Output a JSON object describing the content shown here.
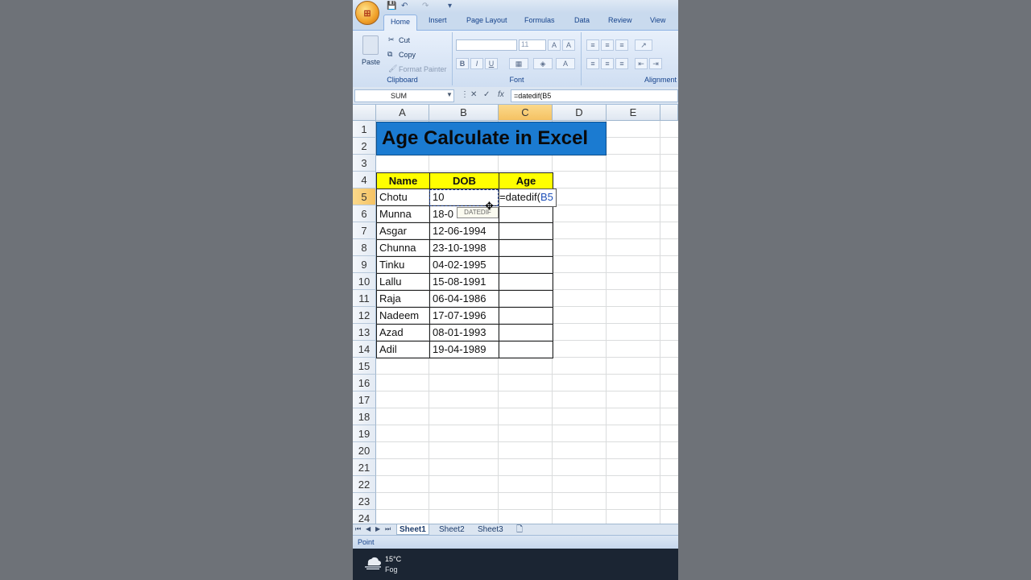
{
  "window": {
    "office_button": "⊞"
  },
  "ribbon_tabs": [
    "Home",
    "Insert",
    "Page Layout",
    "Formulas",
    "Data",
    "Review",
    "View"
  ],
  "clipboard": {
    "paste_label": "Paste",
    "cut_label": "Cut",
    "copy_label": "Copy",
    "format_painter_label": "Format Painter",
    "group_label": "Clipboard"
  },
  "font": {
    "font_size": "11",
    "bold": "B",
    "italic": "I",
    "underline": "U",
    "group_label": "Font"
  },
  "alignment": {
    "group_label": "Alignment"
  },
  "formula_bar": {
    "name_box": "SUM",
    "fx": "fx",
    "formula": "=datedif(B5"
  },
  "columns": [
    "A",
    "B",
    "C",
    "D",
    "E"
  ],
  "rows": [
    "1",
    "2",
    "3",
    "4",
    "5",
    "6",
    "7",
    "8",
    "9",
    "10",
    "11",
    "12",
    "13",
    "14",
    "15",
    "16",
    "17",
    "18",
    "19",
    "20",
    "21",
    "22",
    "23",
    "24"
  ],
  "sheet": {
    "title": "Age Calculate in Excel",
    "headers": {
      "name": "Name",
      "dob": "DOB",
      "age": "Age"
    },
    "data": [
      {
        "name": "Chotu",
        "dob": "10"
      },
      {
        "name": "Munna",
        "dob": "18-0"
      },
      {
        "name": "Asgar",
        "dob": "12-06-1994"
      },
      {
        "name": "Chunna",
        "dob": "23-10-1998"
      },
      {
        "name": "Tinku",
        "dob": "04-02-1995"
      },
      {
        "name": "Lallu",
        "dob": "15-08-1991"
      },
      {
        "name": "Raja",
        "dob": "06-04-1986"
      },
      {
        "name": "Nadeem",
        "dob": "17-07-1996"
      },
      {
        "name": "Azad",
        "dob": "08-01-1993"
      },
      {
        "name": "Adil",
        "dob": "19-04-1989"
      }
    ],
    "edit_cell": {
      "prefix": "=datedif(",
      "ref": "B5"
    },
    "tooltip": "DATEDIF"
  },
  "sheet_tabs": [
    "Sheet1",
    "Sheet2",
    "Sheet3"
  ],
  "status": "Point",
  "taskbar": {
    "temperature": "15°C",
    "condition": "Fog"
  }
}
